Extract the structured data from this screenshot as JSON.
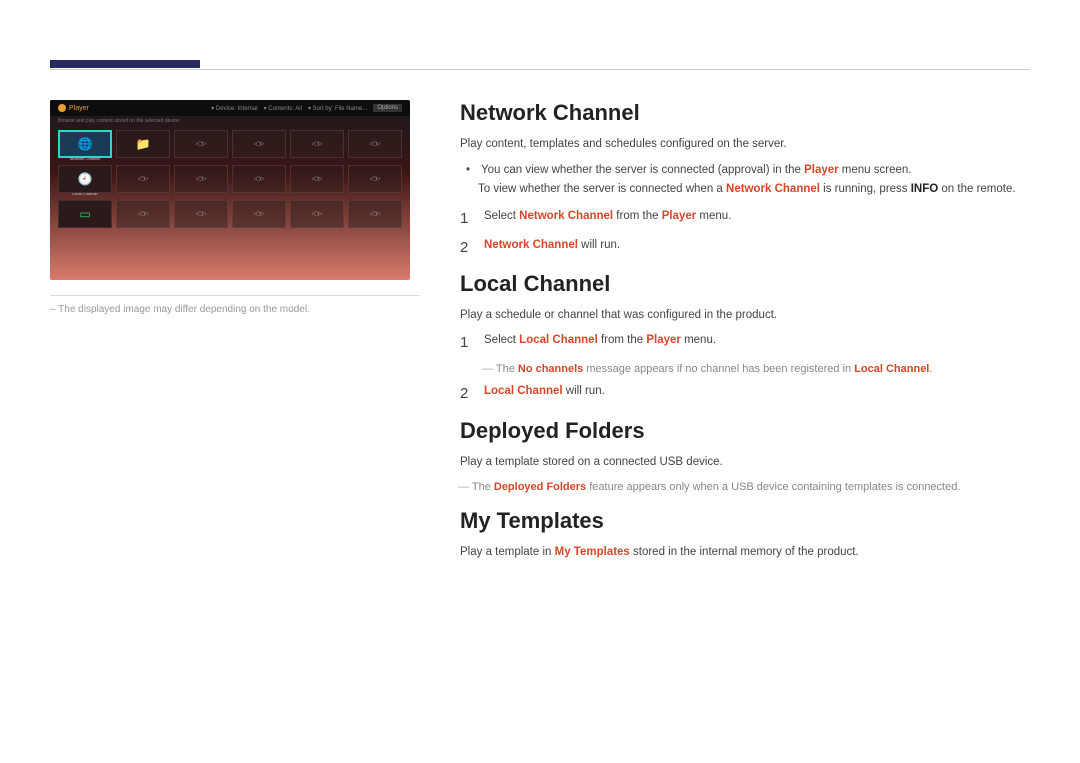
{
  "player": {
    "title": "Player",
    "subtitle": "Browse and play content stored on the selected device.",
    "device_label": "Device: Internal",
    "contents_label": "Contents: All",
    "sort_label": "Sort by: File Name...",
    "options_label": "Options",
    "thumbs": {
      "network_channel": "Network Channel",
      "local_channel": "Local Channel"
    }
  },
  "caption": "The displayed image may differ depending on the model.",
  "sections": {
    "network": {
      "title": "Network Channel",
      "desc": "Play content, templates and schedules configured on the server.",
      "bullet1_a": "You can view whether the server is connected (approval) in the ",
      "bullet1_b": "Player",
      "bullet1_c": " menu screen.",
      "bullet1_d": "To view whether the server is connected when a ",
      "bullet1_e": "Network Channel",
      "bullet1_f": " is running, press ",
      "bullet1_g": "INFO",
      "bullet1_h": " on the remote.",
      "step1_a": "Select ",
      "step1_b": "Network Channel",
      "step1_c": " from the ",
      "step1_d": "Player",
      "step1_e": " menu.",
      "step2_a": "Network Channel",
      "step2_b": " will run."
    },
    "local": {
      "title": "Local Channel",
      "desc": "Play a schedule or channel that was configured in the product.",
      "step1_a": "Select ",
      "step1_b": "Local Channel",
      "step1_c": " from the ",
      "step1_d": "Player",
      "step1_e": " menu.",
      "note_a": "The ",
      "note_b": "No channels",
      "note_c": " message appears if no channel has been registered in ",
      "note_d": "Local Channel",
      "note_e": ".",
      "step2_a": "Local Channel",
      "step2_b": " will run."
    },
    "deployed": {
      "title": "Deployed Folders",
      "desc": "Play a template stored on a connected USB device.",
      "note_a": "The ",
      "note_b": "Deployed Folders",
      "note_c": " feature appears only when a USB device containing templates is connected."
    },
    "templates": {
      "title": "My Templates",
      "desc_a": "Play a template in ",
      "desc_b": "My Templates",
      "desc_c": " stored in the internal memory of the product."
    }
  },
  "nums": {
    "one": "1",
    "two": "2"
  }
}
